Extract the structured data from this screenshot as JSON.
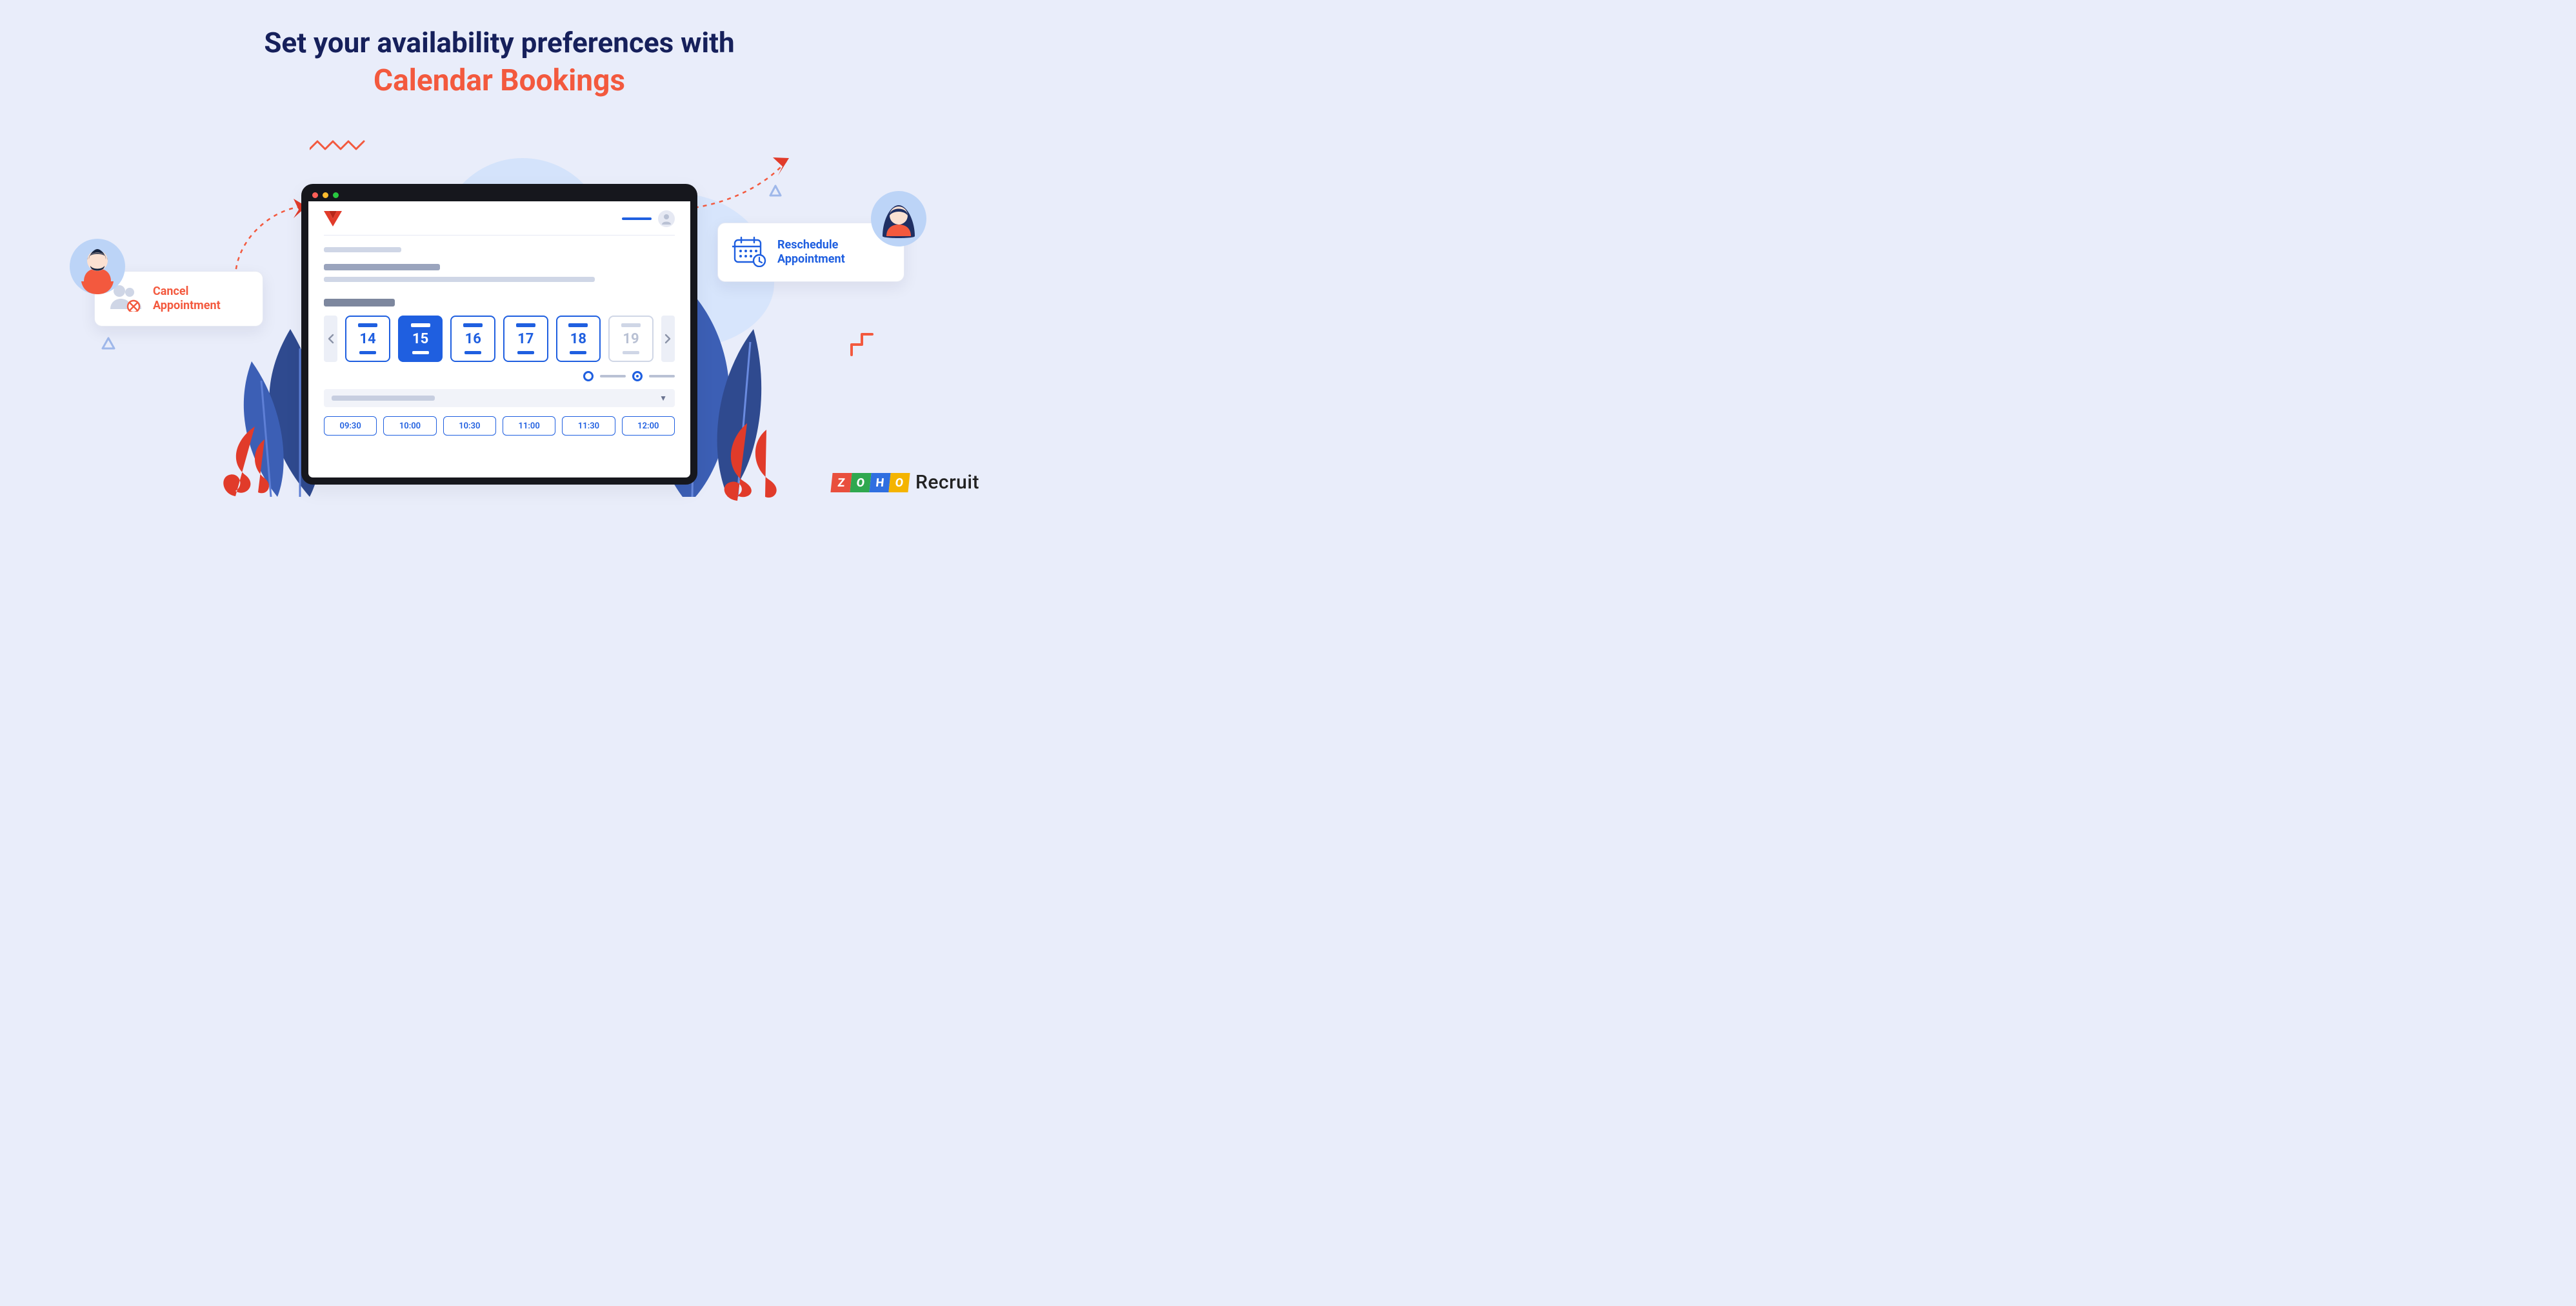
{
  "heading": {
    "line1": "Set your availability preferences with",
    "line2": "Calendar Bookings"
  },
  "popups": {
    "cancel": {
      "line1": "Cancel",
      "line2": "Appointment"
    },
    "reschedule": {
      "line1": "Reschedule",
      "line2": "Appointment"
    }
  },
  "dates": [
    {
      "value": "14",
      "state": "default"
    },
    {
      "value": "15",
      "state": "selected"
    },
    {
      "value": "16",
      "state": "default"
    },
    {
      "value": "17",
      "state": "default"
    },
    {
      "value": "18",
      "state": "default"
    },
    {
      "value": "19",
      "state": "disabled"
    }
  ],
  "times": [
    "09:30",
    "10:00",
    "10:30",
    "11:00",
    "11:30",
    "12:00"
  ],
  "footer": {
    "zoho": [
      "Z",
      "O",
      "H",
      "O"
    ],
    "product": "Recruit"
  }
}
